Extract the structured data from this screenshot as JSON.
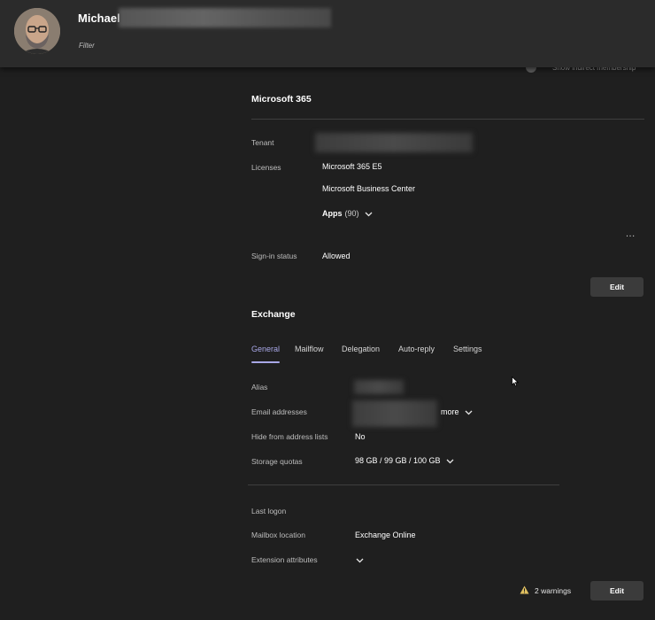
{
  "header": {
    "user_first_name": "Michael",
    "filter_label": "Filter"
  },
  "toggle": {
    "label": "Show indirect membership",
    "on": false
  },
  "m365": {
    "title": "Microsoft 365",
    "tenant_label": "Tenant",
    "licenses_label": "Licenses",
    "licenses": [
      "Microsoft 365 E5",
      "Microsoft Business Center"
    ],
    "apps_label": "Apps",
    "apps_count": "(90)",
    "more_label": "...",
    "signin_label": "Sign-in status",
    "signin_value": "Allowed",
    "edit_label": "Edit"
  },
  "exchange": {
    "title": "Exchange",
    "tabs": [
      {
        "label": "General",
        "active": true
      },
      {
        "label": "Mailflow",
        "active": false
      },
      {
        "label": "Delegation",
        "active": false
      },
      {
        "label": "Auto-reply",
        "active": false
      },
      {
        "label": "Settings",
        "active": false
      }
    ],
    "alias_label": "Alias",
    "email_label": "Email addresses",
    "email_more": "more",
    "hide_label": "Hide from address lists",
    "hide_value": "No",
    "storage_label": "Storage quotas",
    "storage_value": "98 GB / 99 GB / 100 GB",
    "last_logon_label": "Last logon",
    "mailbox_location_label": "Mailbox location",
    "mailbox_location_value": "Exchange Online",
    "extension_label": "Extension attributes",
    "warnings_text": "2 warnings",
    "edit_label": "Edit"
  },
  "colors": {
    "accent": "#a8a7e6",
    "background": "#1f1f1f",
    "header": "#2b2b2b",
    "warning": "#e0c060"
  },
  "icons": [
    "chevron-down-icon",
    "warning-icon",
    "ellipsis-icon",
    "cursor-icon"
  ]
}
